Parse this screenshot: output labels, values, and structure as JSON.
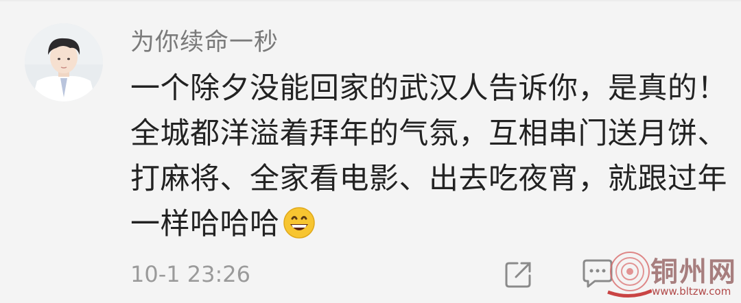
{
  "comment": {
    "username": "为你续命一秒",
    "text": "一个除夕没能回家的武汉人告诉你，是真的！全城都洋溢着拜年的气氛，互相串门送月饼、打麻将、全家看电影、出去吃夜宵，就跟过年一样哈哈哈",
    "emoji": "grinning-face-emoji",
    "timestamp": "10-1 23:26"
  },
  "actions": {
    "share_icon": "share-external-icon",
    "reply_icon": "comment-bubble-icon"
  },
  "watermark": {
    "text": "铜州网",
    "url": "www.bltzw.com"
  },
  "colors": {
    "background": "#f4f4f4",
    "username": "#7a7a7a",
    "text": "#222222",
    "timestamp": "#9a9a9a",
    "watermark_red": "#c94444"
  }
}
